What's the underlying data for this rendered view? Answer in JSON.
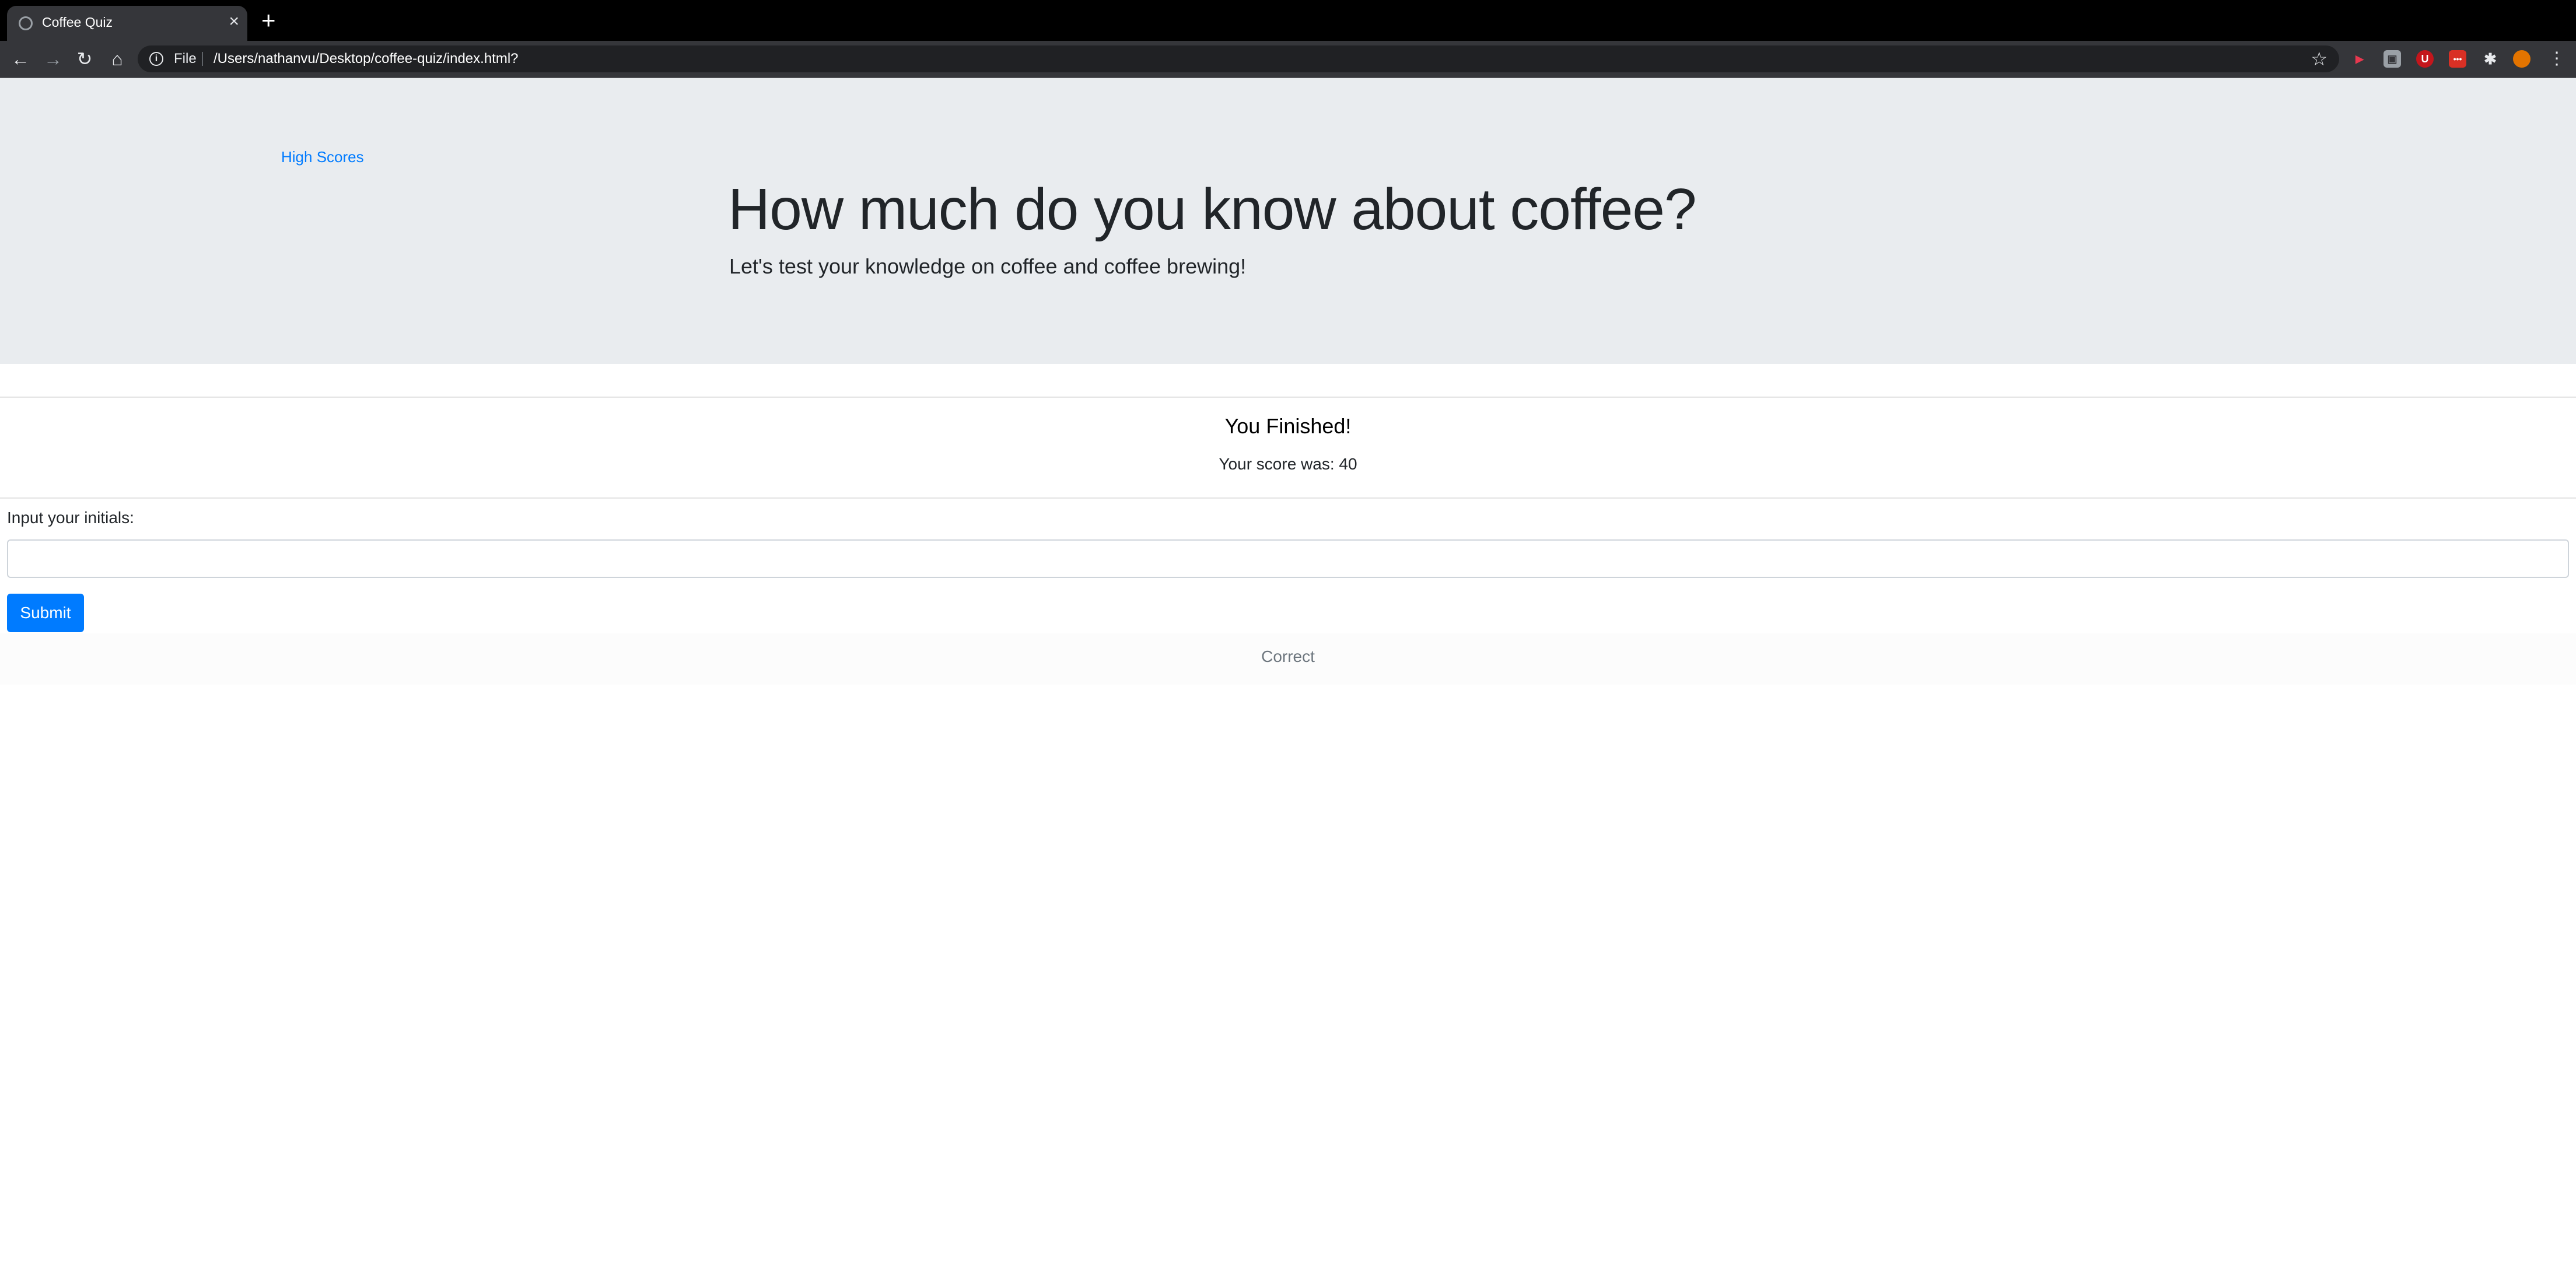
{
  "browser": {
    "tab_title": "Coffee Quiz",
    "tab_close": "×",
    "new_tab": "+",
    "scheme_label": "File",
    "url": "/Users/nathanvu/Desktop/coffee-quiz/index.html?",
    "nav": {
      "back": "←",
      "forward": "→",
      "reload": "↻",
      "home": "⌂"
    },
    "bookmark": "☆",
    "menu": "⋮",
    "extensions": [
      {
        "name": "video-extension-icon",
        "glyph": "▶",
        "color": "#e8384f"
      },
      {
        "name": "grey-extension-icon",
        "glyph": "▣",
        "color": "#9aa0a6"
      },
      {
        "name": "ublock-extension-icon",
        "glyph": "U",
        "color": "#c4161c"
      },
      {
        "name": "red-extension-icon",
        "glyph": "•••",
        "color": "#d93025"
      },
      {
        "name": "puzzle-extensions-icon",
        "glyph": "✱",
        "color": "#35363a"
      },
      {
        "name": "profile-avatar-icon",
        "glyph": "●",
        "color": "#e37400"
      }
    ]
  },
  "page": {
    "high_scores_link": "High Scores",
    "title": "How much do you know about coffee?",
    "subtitle": "Let's test your knowledge on coffee and coffee brewing!",
    "finished_title": "You Finished!",
    "score_label": "Your score was: 40",
    "initials_label": "Input your initials:",
    "initials_value": "",
    "submit_label": "Submit",
    "feedback": "Correct"
  },
  "colors": {
    "link": "#007bff",
    "button": "#007bff",
    "jumbotron": "#e9ecef"
  }
}
